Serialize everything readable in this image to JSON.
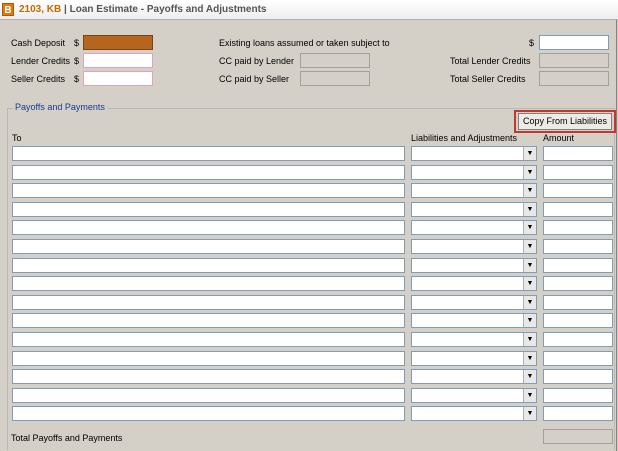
{
  "window": {
    "logo_letter": "B",
    "title_id": "2103, KB",
    "title_sep": " | ",
    "title": "Loan Estimate - Payoffs and Adjustments"
  },
  "top": {
    "cash_deposit": {
      "label": "Cash Deposit",
      "currency": "$",
      "value": ""
    },
    "lender_credits": {
      "label": "Lender Credits",
      "currency": "$",
      "value": ""
    },
    "seller_credits": {
      "label": "Seller Credits",
      "currency": "$",
      "value": ""
    },
    "existing_loans": {
      "label": "Existing loans assumed or taken subject to",
      "currency": "$",
      "value": ""
    },
    "cc_paid_lender": {
      "label": "CC paid by  Lender",
      "value": ""
    },
    "cc_paid_seller": {
      "label": "CC paid by Seller",
      "value": ""
    },
    "total_lender_credits": {
      "label": "Total Lender Credits",
      "value": ""
    },
    "total_seller_credits": {
      "label": "Total Seller Credits",
      "value": ""
    }
  },
  "payoffs": {
    "group_title": "Payoffs and Payments",
    "copy_button_label": "Copy From Liabilities",
    "columns": {
      "to": "To",
      "liabilities": "Liabilities and Adjustments",
      "amount": "Amount"
    },
    "rows": [
      {
        "to": "",
        "liability": "",
        "amount": ""
      },
      {
        "to": "",
        "liability": "",
        "amount": ""
      },
      {
        "to": "",
        "liability": "",
        "amount": ""
      },
      {
        "to": "",
        "liability": "",
        "amount": ""
      },
      {
        "to": "",
        "liability": "",
        "amount": ""
      },
      {
        "to": "",
        "liability": "",
        "amount": ""
      },
      {
        "to": "",
        "liability": "",
        "amount": ""
      },
      {
        "to": "",
        "liability": "",
        "amount": ""
      },
      {
        "to": "",
        "liability": "",
        "amount": ""
      },
      {
        "to": "",
        "liability": "",
        "amount": ""
      },
      {
        "to": "",
        "liability": "",
        "amount": ""
      },
      {
        "to": "",
        "liability": "",
        "amount": ""
      },
      {
        "to": "",
        "liability": "",
        "amount": ""
      },
      {
        "to": "",
        "liability": "",
        "amount": ""
      },
      {
        "to": "",
        "liability": "",
        "amount": ""
      }
    ],
    "total_label": "Total Payoffs and Payments",
    "total_value": ""
  },
  "icons": {
    "dropdown": "chevron-down-icon",
    "logo": "app-logo-icon"
  },
  "colors": {
    "title_id": "#c56a00",
    "cash_deposit_fill": "#b5651d",
    "group_title": "#1a3a8a",
    "highlight": "#c0392b"
  }
}
